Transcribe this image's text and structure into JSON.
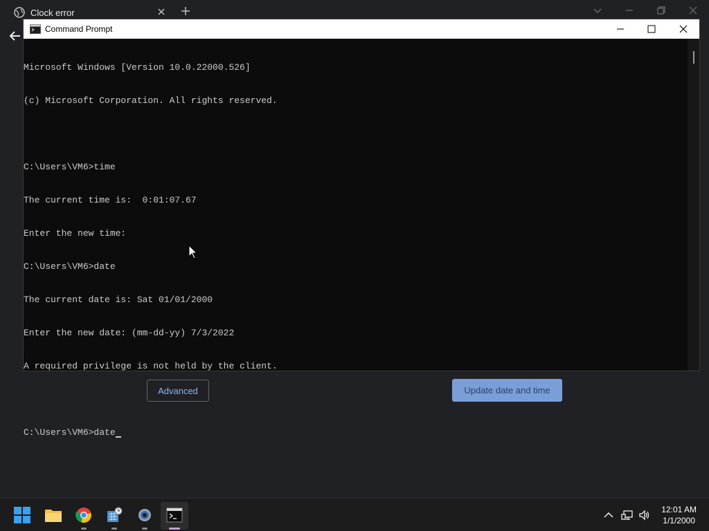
{
  "browser": {
    "tab_title": "Clock error",
    "advanced_label": "Advanced",
    "update_label": "Update date and time"
  },
  "cmd": {
    "title": "Command Prompt",
    "lines": [
      "Microsoft Windows [Version 10.0.22000.526]",
      "(c) Microsoft Corporation. All rights reserved.",
      "",
      "C:\\Users\\VM6>time",
      "The current time is:  0:01:07.67",
      "Enter the new time:",
      "C:\\Users\\VM6>date",
      "The current date is: Sat 01/01/2000",
      "Enter the new date: (mm-dd-yy) 7/3/2022",
      "A required privilege is not held by the client.",
      ""
    ],
    "prompt_line": "C:\\Users\\VM6>date"
  },
  "taskbar": {
    "time": "12:01 AM",
    "date": "1/1/2000",
    "apps": [
      "start-icon",
      "file-explorer-icon",
      "chrome-icon",
      "calculator-icon",
      "settings-icon",
      "terminal-icon"
    ]
  },
  "colors": {
    "accent": "#8ab4f8",
    "console_bg": "#0c0c0c",
    "console_text": "#cccccc"
  }
}
